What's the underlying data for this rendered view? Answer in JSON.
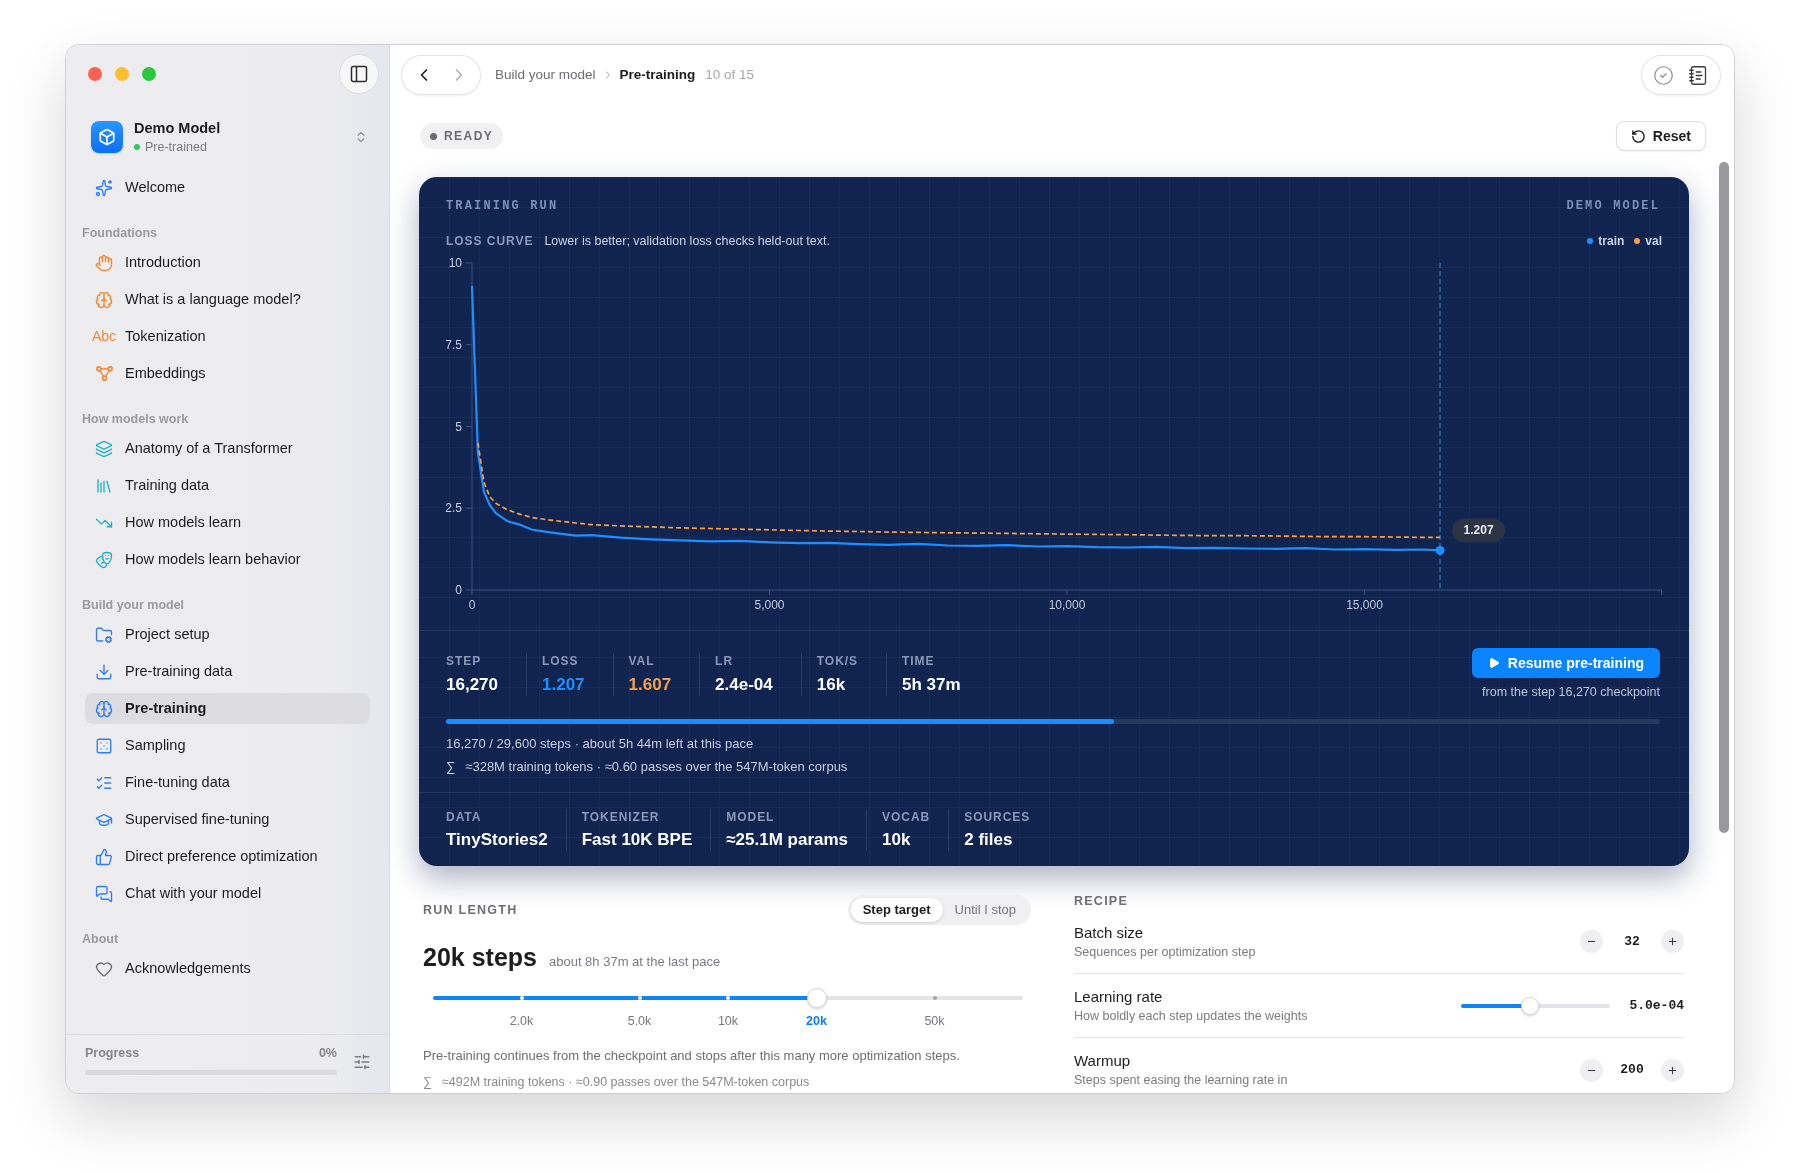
{
  "sidebar": {
    "model": {
      "name": "Demo Model",
      "status": "Pre-trained"
    },
    "sections": [
      {
        "items": [
          {
            "label": "Welcome",
            "selected": false
          }
        ]
      },
      {
        "title": "Foundations",
        "items": [
          {
            "label": "Introduction",
            "selected": false
          },
          {
            "label": "What is a language model?",
            "selected": false
          },
          {
            "label": "Tokenization",
            "icon_text": "Abc",
            "selected": false
          },
          {
            "label": "Embeddings",
            "selected": false
          }
        ]
      },
      {
        "title": "How models work",
        "items": [
          {
            "label": "Anatomy of a Transformer",
            "selected": false
          },
          {
            "label": "Training data",
            "selected": false
          },
          {
            "label": "How models learn",
            "selected": false
          },
          {
            "label": "How models learn behavior",
            "selected": false
          }
        ]
      },
      {
        "title": "Build your model",
        "items": [
          {
            "label": "Project setup",
            "selected": false
          },
          {
            "label": "Pre-training data",
            "selected": false
          },
          {
            "label": "Pre-training",
            "selected": true
          },
          {
            "label": "Sampling",
            "selected": false
          },
          {
            "label": "Fine-tuning data",
            "selected": false
          },
          {
            "label": "Supervised fine-tuning",
            "selected": false
          },
          {
            "label": "Direct preference optimization",
            "selected": false
          },
          {
            "label": "Chat with your model",
            "selected": false
          }
        ]
      },
      {
        "title": "About",
        "items": [
          {
            "label": "Acknowledgements",
            "selected": false
          }
        ]
      }
    ],
    "progress": {
      "label": "Progress",
      "value": "0%"
    }
  },
  "toolbar": {
    "back_disabled": false,
    "forward_disabled": true,
    "breadcrumb": [
      {
        "label": "Build your model",
        "current": false
      },
      {
        "label": "Pre-training",
        "current": true
      }
    ],
    "position": "10 of 15"
  },
  "status": {
    "label": "READY"
  },
  "reset_button": {
    "label": "Reset"
  },
  "training_run": {
    "title": "TRAINING RUN",
    "model_label": "DEMO MODEL",
    "chart_caption": "Lower is better; validation loss checks held-out text.",
    "chart_data": {
      "type": "line",
      "title": "LOSS CURVE",
      "legend": "upper right",
      "x": [
        0,
        100,
        200,
        300,
        400,
        600,
        800,
        1000,
        1250,
        1500,
        1750,
        2000,
        2500,
        3000,
        3500,
        4000,
        4500,
        5000,
        5500,
        6000,
        6500,
        7000,
        7500,
        8000,
        8500,
        9000,
        9500,
        10000,
        10500,
        11000,
        11500,
        12000,
        12500,
        13000,
        13500,
        14000,
        14500,
        15000,
        15500,
        16000,
        16270
      ],
      "series": [
        {
          "name": "train",
          "color": "#1e8fff",
          "line_style": "solid",
          "values": [
            9.3,
            4.2,
            3.0,
            2.6,
            2.35,
            2.1,
            2.0,
            1.85,
            1.78,
            1.72,
            1.66,
            1.68,
            1.6,
            1.55,
            1.52,
            1.49,
            1.5,
            1.46,
            1.43,
            1.44,
            1.4,
            1.38,
            1.41,
            1.36,
            1.35,
            1.37,
            1.33,
            1.34,
            1.31,
            1.3,
            1.32,
            1.28,
            1.29,
            1.27,
            1.26,
            1.28,
            1.24,
            1.25,
            1.23,
            1.24,
            1.21
          ]
        },
        {
          "name": "val",
          "color": "#f5a04a",
          "line_style": "dashed",
          "values": [
            null,
            4.5,
            3.3,
            2.85,
            2.65,
            2.45,
            2.32,
            2.22,
            2.15,
            2.1,
            2.05,
            2.0,
            1.96,
            1.93,
            1.9,
            1.88,
            1.86,
            1.84,
            1.82,
            1.8,
            1.79,
            1.77,
            1.76,
            1.75,
            1.74,
            1.73,
            1.72,
            1.71,
            1.7,
            1.69,
            1.68,
            1.67,
            1.66,
            1.66,
            1.65,
            1.64,
            1.63,
            1.63,
            1.62,
            1.61,
            1.61
          ]
        }
      ],
      "xlim": [
        0,
        20000
      ],
      "ylim": [
        0,
        10
      ],
      "xticks": [
        {
          "value": 0,
          "label": "0"
        },
        {
          "value": 5000,
          "label": "5,000"
        },
        {
          "value": 10000,
          "label": "10,000"
        },
        {
          "value": 15000,
          "label": "15,000"
        }
      ],
      "yticks": [
        {
          "value": 0,
          "label": "0"
        },
        {
          "value": 2.5,
          "label": "2.5"
        },
        {
          "value": 5,
          "label": "5"
        },
        {
          "value": 7.5,
          "label": "7.5"
        },
        {
          "value": 10,
          "label": "10"
        }
      ],
      "ref_lines": [
        {
          "axis": "x",
          "value": 16270,
          "color": "#3a86d6",
          "line_style": "dashed"
        }
      ],
      "annotations": [
        {
          "x": 16270,
          "y": 1.21,
          "text": "1.207"
        }
      ]
    },
    "stats": [
      {
        "label": "STEP",
        "value": "16,270",
        "color": "#ffffff"
      },
      {
        "label": "LOSS",
        "value": "1.207",
        "color": "#1e8fff"
      },
      {
        "label": "VAL",
        "value": "1.607",
        "color": "#f5a04a"
      },
      {
        "label": "LR",
        "value": "2.4e-04",
        "color": "#ffffff"
      },
      {
        "label": "TOK/S",
        "value": "16k",
        "color": "#ffffff"
      },
      {
        "label": "TIME",
        "value": "5h 37m",
        "color": "#ffffff"
      }
    ],
    "resume": {
      "label": "Resume pre-training",
      "caption": "from the step 16,270 checkpoint"
    },
    "progress": {
      "level": 0.55,
      "summary": "16,270 / 29,600 steps · about 5h 44m left at this pace",
      "symbol": "∑",
      "tokens": "≈328M training tokens · ≈0.60 passes over the 547M-token corpus"
    },
    "details": [
      {
        "label": "DATA",
        "value": "TinyStories2"
      },
      {
        "label": "TOKENIZER",
        "value": "Fast 10K BPE"
      },
      {
        "label": "MODEL",
        "value": "≈25.1M params"
      },
      {
        "label": "VOCAB",
        "value": "10k"
      },
      {
        "label": "SOURCES",
        "value": "2 files"
      }
    ]
  },
  "run_length": {
    "title": "RUN LENGTH",
    "modes": [
      {
        "label": "Step target",
        "selected": true
      },
      {
        "label": "Until I stop",
        "selected": false
      }
    ],
    "value": "20k steps",
    "estimate": "about 8h 37m at the last pace",
    "stops": [
      {
        "label": "2.0k",
        "selected": false
      },
      {
        "label": "5.0k",
        "selected": false
      },
      {
        "label": "10k",
        "selected": false
      },
      {
        "label": "20k",
        "selected": true
      },
      {
        "label": "50k",
        "selected": false
      }
    ],
    "description": "Pre-training continues from the checkpoint and stops after this many more optimization steps.",
    "symbol": "∑",
    "tokens": "≈492M training tokens · ≈0.90 passes over the 547M-token corpus"
  },
  "recipe": {
    "title": "RECIPE",
    "rows": [
      {
        "kind": "stepper",
        "label": "Batch size",
        "hint": "Sequences per optimization step",
        "value": "32"
      },
      {
        "kind": "slider",
        "label": "Learning rate",
        "hint": "How boldly each step updates the weights",
        "level": 0.46,
        "value": "5.0e-04"
      },
      {
        "kind": "stepper",
        "label": "Warmup",
        "hint": "Steps spent easing the learning rate in",
        "value": "200"
      }
    ]
  }
}
